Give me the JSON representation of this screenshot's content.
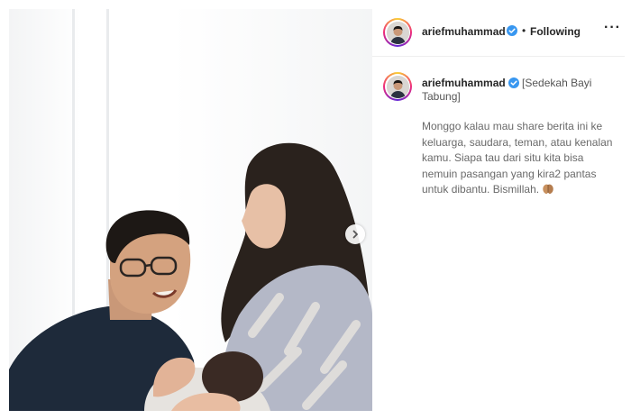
{
  "post": {
    "username": "ariefmuhammad",
    "separator": "•",
    "follow_label": "Following",
    "more_label": "···",
    "caption_title": "[Sedekah Bayi Tabung]",
    "caption_body": "Monggo kalau mau share berita ini ke keluarga, saudara, teman, atau kenalan kamu. Siapa tau dari situ kita bisa nemuin pasangan yang kira2 pantas untuk dibantu. Bismillah.",
    "caption_emoji": "praying-hands"
  },
  "colors": {
    "verified": "#3897f0",
    "text_primary": "#262626",
    "text_secondary": "#6a6a6a",
    "story_ring_start": "#f9ce34",
    "story_ring_mid": "#ee2a7b"
  },
  "icons": {
    "verified": "verified-badge-icon",
    "next": "chevron-right-icon"
  }
}
